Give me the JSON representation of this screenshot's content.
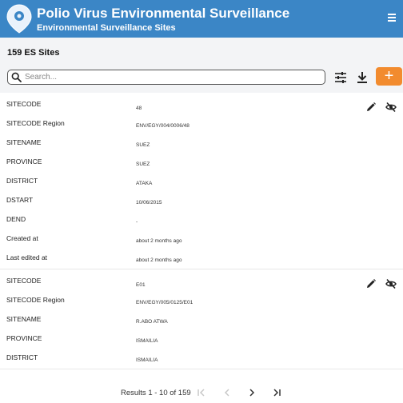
{
  "header": {
    "title": "Polio Virus Environmental Surveillance",
    "subtitle": "Environmental Surveillance Sites"
  },
  "toolbar": {
    "count_label": "159 ES Sites",
    "search_placeholder": "Search...",
    "add_label": "+"
  },
  "records": [
    {
      "fields": [
        {
          "label": "SITECODE",
          "value": "48"
        },
        {
          "label": "SITECODE Region",
          "value": "ENV/EGY/004/0006/48"
        },
        {
          "label": "SITENAME",
          "value": "SUEZ"
        },
        {
          "label": "PROVINCE",
          "value": "SUEZ"
        },
        {
          "label": "DISTRICT",
          "value": "ATAKA"
        },
        {
          "label": "DSTART",
          "value": "10/06/2015"
        },
        {
          "label": "DEND",
          "value": "-"
        },
        {
          "label": "Created at",
          "value": "about 2 months ago"
        },
        {
          "label": "Last edited at",
          "value": "about 2 months ago"
        }
      ]
    },
    {
      "fields": [
        {
          "label": "SITECODE",
          "value": "E01"
        },
        {
          "label": "SITECODE Region",
          "value": "ENV/EGY/005/0125/E01"
        },
        {
          "label": "SITENAME",
          "value": "R.ABO ATWA"
        },
        {
          "label": "PROVINCE",
          "value": "ISMAILIA"
        },
        {
          "label": "DISTRICT",
          "value": "ISMAILIA"
        }
      ]
    }
  ],
  "pagination": {
    "results_text": "Results 1 - 10 of 159"
  },
  "colors": {
    "header_bg": "#3b86c6",
    "accent_orange": "#f28b2e",
    "toolbar_bg": "#f3f4f6"
  },
  "icons": {
    "logo": "map-pin-icon",
    "menu": "hamburger-menu-icon",
    "search": "search-icon",
    "filter": "tune-filter-icon",
    "download": "download-icon",
    "edit": "pencil-edit-icon",
    "hide": "eye-off-icon",
    "first": "first-page-icon",
    "prev": "chevron-left-icon",
    "next": "chevron-right-icon",
    "last": "last-page-icon"
  }
}
